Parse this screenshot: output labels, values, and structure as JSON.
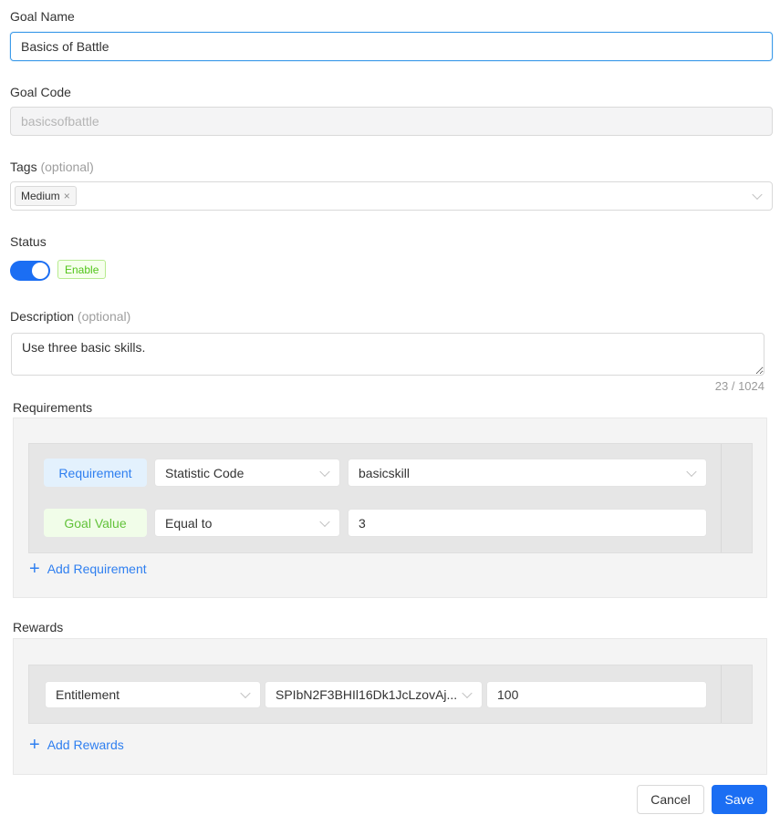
{
  "goal_name": {
    "label": "Goal Name",
    "value": "Basics of Battle"
  },
  "goal_code": {
    "label": "Goal Code",
    "value": "basicsofbattle"
  },
  "tags": {
    "label": "Tags",
    "optional": "(optional)",
    "items": [
      {
        "label": "Medium",
        "remove_icon": "×"
      }
    ]
  },
  "status": {
    "label": "Status",
    "enabled": true,
    "badge": "Enable"
  },
  "description": {
    "label": "Description",
    "optional": "(optional)",
    "value": "Use three basic skills.",
    "counter": "23 / 1024"
  },
  "requirements": {
    "label": "Requirements",
    "rows": [
      {
        "pill": "Requirement",
        "select": "Statistic Code",
        "value": "basicskill"
      },
      {
        "pill": "Goal Value",
        "select": "Equal to",
        "value": "3"
      }
    ],
    "add_label": "Add Requirement"
  },
  "rewards": {
    "label": "Rewards",
    "rows": [
      {
        "type": "Entitlement",
        "item": "SPIbN2F3BHIl16Dk1JcLzovAj...",
        "quantity": "100"
      }
    ],
    "add_label": "Add Rewards"
  },
  "footer": {
    "cancel_label": "Cancel",
    "save_label": "Save"
  },
  "colors": {
    "primary": "#1b6ef3",
    "link": "#2f7ff0",
    "success": "#52c41a"
  }
}
